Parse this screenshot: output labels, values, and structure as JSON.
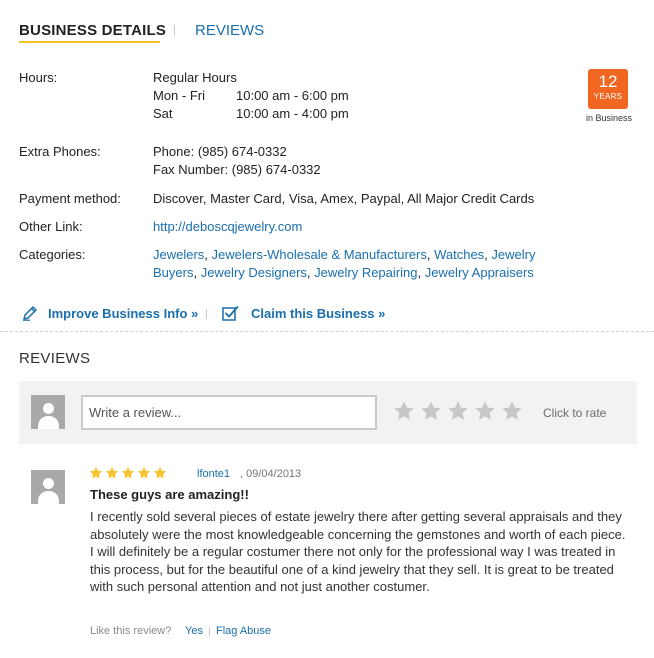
{
  "tabs": {
    "active": "BUSINESS DETAILS",
    "reviews": "REVIEWS"
  },
  "hours": {
    "label": "Hours:",
    "title": "Regular Hours",
    "rows": [
      {
        "day": "Mon - Fri",
        "time": "10:00 am - 6:00 pm"
      },
      {
        "day": "Sat",
        "time": "10:00 am - 4:00 pm"
      }
    ]
  },
  "badge": {
    "number": "12",
    "unit": "YEARS",
    "caption": "in Business",
    "color": "#f16722"
  },
  "extra_phones": {
    "label": "Extra Phones:",
    "phone": "Phone: (985) 674-0332",
    "fax": "Fax Number: (985) 674-0332"
  },
  "payment": {
    "label": "Payment method:",
    "value": "Discover, Master Card, Visa, Amex, Paypal, All Major Credit Cards"
  },
  "other_link": {
    "label": "Other Link:",
    "value": "http://deboscqjewelry.com"
  },
  "categories": {
    "label": "Categories:",
    "items": [
      "Jewelers",
      "Jewelers-Wholesale & Manufacturers",
      "Watches",
      "Jewelry Buyers",
      "Jewelry Designers",
      "Jewelry Repairing",
      "Jewelry Appraisers"
    ]
  },
  "actions": {
    "improve": "Improve Business Info »",
    "claim": "Claim this Business »"
  },
  "reviews_section": {
    "heading": "REVIEWS",
    "write_placeholder": "Write a review...",
    "click_to_rate": "Click to rate",
    "empty_star_color": "#c7c7c7"
  },
  "review": {
    "rating": 5,
    "reviewer": "lfonte1",
    "date": ", 09/04/2013",
    "title": "These guys are amazing!!",
    "body": "I recently sold several pieces of estate jewelry there after getting several appraisals and they absolutely were the most knowledgeable concerning the gemstones and worth of each piece. I will definitely be a regular costumer there not only for the professional way I was treated in this process, but for the beautiful one of a kind jewelry that they sell. It is great to be treated with such personal attention and not just another costumer.",
    "like_prompt": "Like this review?",
    "like_yes": "Yes",
    "flag": "Flag Abuse",
    "star_color": "#f6c22e"
  },
  "colors": {
    "link": "#1a6fad",
    "accent_underline": "#f6c22e"
  },
  "icons": {
    "improve": "pencil-icon",
    "claim": "checkbox-icon",
    "avatar": "user-silhouette-icon",
    "star": "star-icon"
  }
}
